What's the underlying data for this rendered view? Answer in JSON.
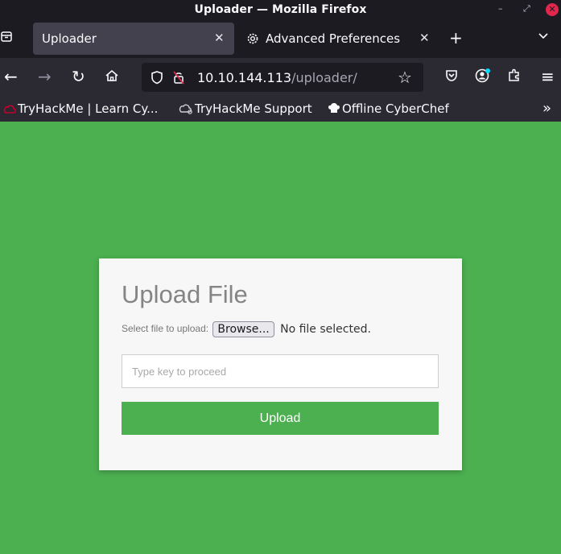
{
  "window": {
    "title": "Uploader — Mozilla Firefox",
    "minimize_glyph": "–",
    "restore_glyph": "⤢",
    "close_glyph": "✕"
  },
  "tabs": [
    {
      "label": "Uploader",
      "active": true,
      "close_glyph": "✕"
    },
    {
      "label": "Advanced Preferences",
      "active": false,
      "icon": "gear-icon",
      "close_glyph": "✕"
    }
  ],
  "tabbar": {
    "new_tab_glyph": "+",
    "all_tabs_glyph": "⌄"
  },
  "nav": {
    "back_glyph": "←",
    "forward_glyph": "→",
    "reload_glyph": "↻",
    "menu_glyph": "≡"
  },
  "urlbar": {
    "host": "10.10.144.113",
    "path": "/uploader/",
    "bookmark_star_glyph": "☆"
  },
  "bookmarks": {
    "items": [
      {
        "label": "TryHackMe | Learn Cy...",
        "icon": "tryhackme-cloud-icon"
      },
      {
        "label": "TryHackMe Support",
        "icon": "support-cloud-icon"
      },
      {
        "label": "Offline CyberChef",
        "icon": "chef-hat-icon"
      }
    ],
    "overflow_glyph": "»"
  },
  "upload_form": {
    "heading": "Upload File",
    "select_label": "Select file to upload:",
    "browse_label": "Browse...",
    "no_file_text": "No file selected.",
    "key_placeholder": "Type key to proceed",
    "key_value": "",
    "submit_label": "Upload"
  },
  "colors": {
    "page_background": "#4caf50",
    "button": "#4caf50",
    "card": "#f7f7f7",
    "browser_chrome": "#2b2a33",
    "titlebar": "#1c1b22"
  }
}
